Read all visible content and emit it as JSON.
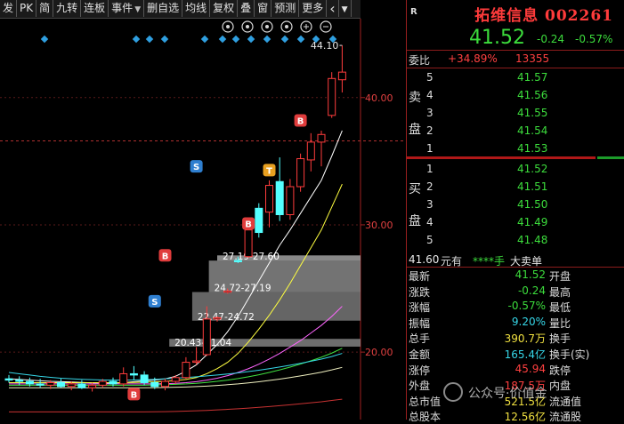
{
  "toolbar": {
    "buttons": [
      {
        "label": "发",
        "arrow": false
      },
      {
        "label": "PK",
        "arrow": false
      },
      {
        "label": "简",
        "arrow": false
      },
      {
        "label": "九转",
        "arrow": false
      },
      {
        "label": "连板",
        "arrow": false
      },
      {
        "label": "事件",
        "arrow": true
      },
      {
        "label": "删自选",
        "arrow": false
      },
      {
        "label": "均线",
        "arrow": false
      },
      {
        "label": "复权",
        "arrow": false
      },
      {
        "label": "叠",
        "arrow": false
      },
      {
        "label": "窗",
        "arrow": false
      },
      {
        "label": "预测",
        "arrow": false
      },
      {
        "label": "更多",
        "arrow": false
      }
    ],
    "back_icon": "chevron-left-icon",
    "menu_icon": "dropdown-icon"
  },
  "chart_icons": [
    "eye-icon",
    "refresh-icon",
    "hand-icon",
    "undo-icon",
    "zoom-in-icon",
    "zoom-out-icon"
  ],
  "chart_data": {
    "type": "candlestick",
    "y_ticks": [
      "40.00",
      "30.00",
      "20.00"
    ],
    "y_tick_values": [
      40,
      30,
      20
    ],
    "ylim": [
      14.7,
      46.2
    ],
    "high_label": "44.10",
    "high_value": 44.1,
    "dashed_reference": 36.6,
    "candles": [
      {
        "o": 17.9,
        "h": 18.2,
        "l": 17.6,
        "c": 17.8
      },
      {
        "o": 17.8,
        "h": 18.1,
        "l": 17.4,
        "c": 17.7
      },
      {
        "o": 17.7,
        "h": 18.0,
        "l": 17.3,
        "c": 17.5
      },
      {
        "o": 17.5,
        "h": 17.9,
        "l": 17.2,
        "c": 17.4
      },
      {
        "o": 17.4,
        "h": 17.8,
        "l": 17.1,
        "c": 17.6
      },
      {
        "o": 17.6,
        "h": 17.9,
        "l": 17.2,
        "c": 17.3
      },
      {
        "o": 17.3,
        "h": 17.7,
        "l": 17.0,
        "c": 17.5
      },
      {
        "o": 17.5,
        "h": 17.8,
        "l": 17.1,
        "c": 17.2
      },
      {
        "o": 17.2,
        "h": 17.6,
        "l": 16.9,
        "c": 17.4
      },
      {
        "o": 17.4,
        "h": 17.9,
        "l": 17.2,
        "c": 17.7
      },
      {
        "o": 17.7,
        "h": 18.0,
        "l": 17.3,
        "c": 17.5
      },
      {
        "o": 17.5,
        "h": 18.8,
        "l": 17.3,
        "c": 18.3
      },
      {
        "o": 18.3,
        "h": 18.9,
        "l": 17.8,
        "c": 18.2
      },
      {
        "o": 18.2,
        "h": 18.5,
        "l": 17.4,
        "c": 17.6
      },
      {
        "o": 17.6,
        "h": 18.0,
        "l": 17.1,
        "c": 17.3
      },
      {
        "o": 17.3,
        "h": 17.9,
        "l": 17.0,
        "c": 17.7
      },
      {
        "o": 17.7,
        "h": 18.2,
        "l": 17.5,
        "c": 18.0
      },
      {
        "o": 18.0,
        "h": 19.6,
        "l": 17.9,
        "c": 19.2
      },
      {
        "o": 19.2,
        "h": 20.4,
        "l": 19.0,
        "c": 19.3
      },
      {
        "o": 19.8,
        "h": 23.6,
        "l": 19.7,
        "c": 22.6
      },
      {
        "o": 22.6,
        "h": 22.8,
        "l": 22.4,
        "c": 22.7
      },
      {
        "o": 24.7,
        "h": 25.0,
        "l": 24.6,
        "c": 24.8
      },
      {
        "o": 27.2,
        "h": 27.5,
        "l": 27.0,
        "c": 27.1
      },
      {
        "o": 27.5,
        "h": 30.3,
        "l": 27.4,
        "c": 29.6
      },
      {
        "o": 31.3,
        "h": 31.7,
        "l": 29.0,
        "c": 29.4
      },
      {
        "o": 31.0,
        "h": 33.5,
        "l": 29.8,
        "c": 33.1
      },
      {
        "o": 33.4,
        "h": 35.3,
        "l": 30.3,
        "c": 30.8
      },
      {
        "o": 30.8,
        "h": 33.6,
        "l": 30.4,
        "c": 33.0
      },
      {
        "o": 33.0,
        "h": 35.6,
        "l": 32.6,
        "c": 35.2
      },
      {
        "o": 35.1,
        "h": 37.2,
        "l": 34.2,
        "c": 36.5
      },
      {
        "o": 36.5,
        "h": 37.4,
        "l": 34.6,
        "c": 37.1
      },
      {
        "o": 38.6,
        "h": 42.0,
        "l": 38.4,
        "c": 41.5
      },
      {
        "o": 41.4,
        "h": 44.1,
        "l": 40.4,
        "c": 42.0
      }
    ],
    "ma_series": [
      {
        "color": "#ffffff",
        "values": [
          17.9,
          17.85,
          17.8,
          17.75,
          17.7,
          17.68,
          17.65,
          17.62,
          17.58,
          17.57,
          17.56,
          17.6,
          17.68,
          17.75,
          17.8,
          17.9,
          18.1,
          18.5,
          19.0,
          19.8,
          20.6,
          21.6,
          22.8,
          24.2,
          25.6,
          27.0,
          28.4,
          29.6,
          30.9,
          32.2,
          33.5,
          35.4,
          37.4
        ]
      },
      {
        "color": "#ffff40",
        "values": [
          17.6,
          17.6,
          17.6,
          17.6,
          17.6,
          17.6,
          17.6,
          17.6,
          17.6,
          17.6,
          17.6,
          17.6,
          17.62,
          17.64,
          17.66,
          17.7,
          17.76,
          17.85,
          18.0,
          18.3,
          18.7,
          19.2,
          19.9,
          20.8,
          21.8,
          22.9,
          24.1,
          25.4,
          26.8,
          28.2,
          29.6,
          31.4,
          33.2
        ]
      },
      {
        "color": "#ff66ff",
        "values": [
          17.5,
          17.5,
          17.5,
          17.5,
          17.5,
          17.5,
          17.5,
          17.5,
          17.5,
          17.5,
          17.5,
          17.5,
          17.5,
          17.5,
          17.5,
          17.52,
          17.55,
          17.6,
          17.68,
          17.8,
          17.95,
          18.15,
          18.4,
          18.7,
          19.05,
          19.45,
          19.9,
          20.4,
          20.9,
          21.5,
          22.1,
          22.8,
          23.6
        ]
      },
      {
        "color": "#40e040",
        "values": [
          17.4,
          17.4,
          17.4,
          17.4,
          17.4,
          17.4,
          17.4,
          17.4,
          17.4,
          17.4,
          17.4,
          17.4,
          17.4,
          17.4,
          17.42,
          17.44,
          17.47,
          17.5,
          17.55,
          17.62,
          17.7,
          17.8,
          17.92,
          18.06,
          18.22,
          18.4,
          18.6,
          18.82,
          19.06,
          19.32,
          19.6,
          19.92,
          20.3
        ]
      },
      {
        "color": "#36d6e7",
        "values": [
          18.4,
          18.3,
          18.2,
          18.1,
          18.02,
          17.95,
          17.9,
          17.86,
          17.83,
          17.81,
          17.8,
          17.8,
          17.81,
          17.83,
          17.86,
          17.9,
          17.95,
          18.0,
          18.06,
          18.13,
          18.2,
          18.28,
          18.37,
          18.47,
          18.58,
          18.7,
          18.83,
          18.97,
          19.12,
          19.28,
          19.45,
          19.65,
          19.9
        ]
      },
      {
        "color": "#f0f0c0",
        "values": [
          17.2,
          17.2,
          17.2,
          17.2,
          17.2,
          17.2,
          17.2,
          17.2,
          17.2,
          17.2,
          17.2,
          17.2,
          17.2,
          17.2,
          17.21,
          17.22,
          17.24,
          17.26,
          17.29,
          17.33,
          17.38,
          17.44,
          17.5,
          17.58,
          17.67,
          17.77,
          17.88,
          18.0,
          18.13,
          18.27,
          18.42,
          18.6,
          18.8
        ]
      },
      {
        "color": "#c83232",
        "values": [
          15.3,
          15.3,
          15.3,
          15.3,
          15.3,
          15.3,
          15.3,
          15.3,
          15.3,
          15.3,
          15.3,
          15.3,
          15.3,
          15.3,
          15.31,
          15.32,
          15.34,
          15.36,
          15.39,
          15.42,
          15.46,
          15.5,
          15.55,
          15.6,
          15.66,
          15.72,
          15.79,
          15.86,
          15.94,
          16.02,
          16.1,
          16.2,
          16.3
        ]
      }
    ],
    "zones": [
      {
        "label": "27.19-27.60",
        "low": 27.19,
        "high": 27.6,
        "fill": "#a0a0a0",
        "opacity": 0.85
      },
      {
        "label": "24.72-27.19",
        "low": 24.72,
        "high": 27.19,
        "fill": "#999999",
        "opacity": 0.75
      },
      {
        "label": "22.47-24.72",
        "low": 22.47,
        "high": 24.72,
        "fill": "#909090",
        "opacity": 0.7
      },
      {
        "label": "20.43-21.04",
        "low": 20.43,
        "high": 21.04,
        "fill": "#8a8a8a",
        "opacity": 0.8
      }
    ],
    "signals": [
      {
        "type": "B",
        "i": 12,
        "price": 16.7,
        "color": "#e03c3c"
      },
      {
        "type": "S",
        "i": 14,
        "price": 24.0,
        "color": "#2f7fd0"
      },
      {
        "type": "B",
        "i": 15,
        "price": 27.6,
        "color": "#e03c3c"
      },
      {
        "type": "S",
        "i": 18,
        "price": 34.6,
        "color": "#2f7fd0"
      },
      {
        "type": "B",
        "i": 23,
        "price": 30.1,
        "color": "#e03c3c"
      },
      {
        "type": "T",
        "i": 25,
        "price": 34.3,
        "color": "#e8a020"
      },
      {
        "type": "B",
        "i": 28,
        "price": 38.2,
        "color": "#e03c3c"
      }
    ],
    "top_markers": 2
  },
  "quote": {
    "r_label": "R",
    "name": "拓维信息 002261",
    "price": "41.52",
    "change": "-0.24",
    "change_pct": "-0.57%",
    "weibi_label": "委比",
    "weibi_value": "+34.89%",
    "weicha_value": "13355",
    "sell_label": [
      "卖",
      "盘"
    ],
    "buy_label": [
      "买",
      "盘"
    ],
    "asks": [
      {
        "level": "5",
        "price": "41.57"
      },
      {
        "level": "4",
        "price": "41.56"
      },
      {
        "level": "3",
        "price": "41.55"
      },
      {
        "level": "2",
        "price": "41.54"
      },
      {
        "level": "1",
        "price": "41.53"
      }
    ],
    "bids": [
      {
        "level": "1",
        "price": "41.52"
      },
      {
        "level": "2",
        "price": "41.51"
      },
      {
        "level": "3",
        "price": "41.50"
      },
      {
        "level": "4",
        "price": "41.49"
      },
      {
        "level": "5",
        "price": "41.48"
      }
    ],
    "big_order": {
      "price": "41.60",
      "unit": "元有",
      "qty": "****手",
      "label": "大卖单"
    },
    "stats": [
      {
        "l": "最新",
        "v": "41.52",
        "vc": "grn",
        "r": "开盘"
      },
      {
        "l": "涨跌",
        "v": "-0.24",
        "vc": "grn",
        "r": "最高"
      },
      {
        "l": "涨幅",
        "v": "-0.57%",
        "vc": "grn",
        "r": "最低"
      },
      {
        "l": "振幅",
        "v": "9.20%",
        "vc": "cyan",
        "r": "量比"
      },
      {
        "l": "总手",
        "v": "390.7万",
        "vc": "yel",
        "r": "换手"
      },
      {
        "l": "金额",
        "v": "165.4亿",
        "vc": "cyan",
        "r": "换手(实)"
      },
      {
        "l": "涨停",
        "v": "45.94",
        "vc": "red",
        "r": "跌停"
      },
      {
        "l": "外盘",
        "v": "187.5万",
        "vc": "red",
        "r": "内盘"
      },
      {
        "l": "总市值",
        "v": "521.5亿",
        "vc": "yel",
        "r": "流通值"
      },
      {
        "l": "总股本",
        "v": "12.56亿",
        "vc": "yel",
        "r": "流通股"
      }
    ]
  },
  "watermark": "公众号·价值金"
}
